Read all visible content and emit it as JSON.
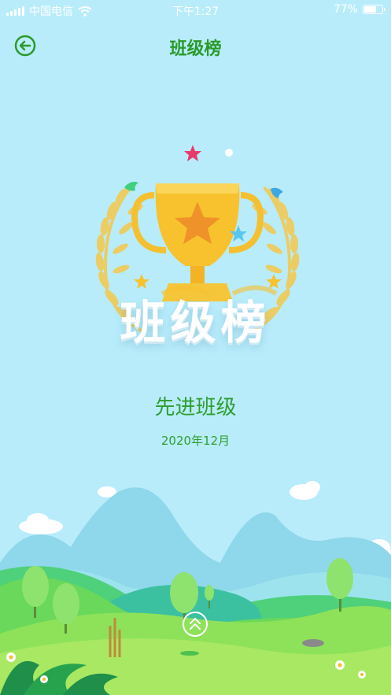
{
  "status_bar": {
    "carrier": "中国电信",
    "time": "下午1:27",
    "battery_percent": "77%",
    "battery_level": 0.77
  },
  "nav": {
    "title": "班级榜",
    "back_icon": "back-arrow-circle-icon"
  },
  "banner": {
    "text": "班级榜",
    "icon": "trophy-icon"
  },
  "award": {
    "title": "先进班级",
    "date": "2020年12月"
  },
  "footer": {
    "scroll_icon": "double-chevron-up-icon"
  },
  "colors": {
    "sky": "#b8ecfb",
    "accent_green": "#2e9e2e",
    "trophy_gold": "#f7c22e"
  }
}
